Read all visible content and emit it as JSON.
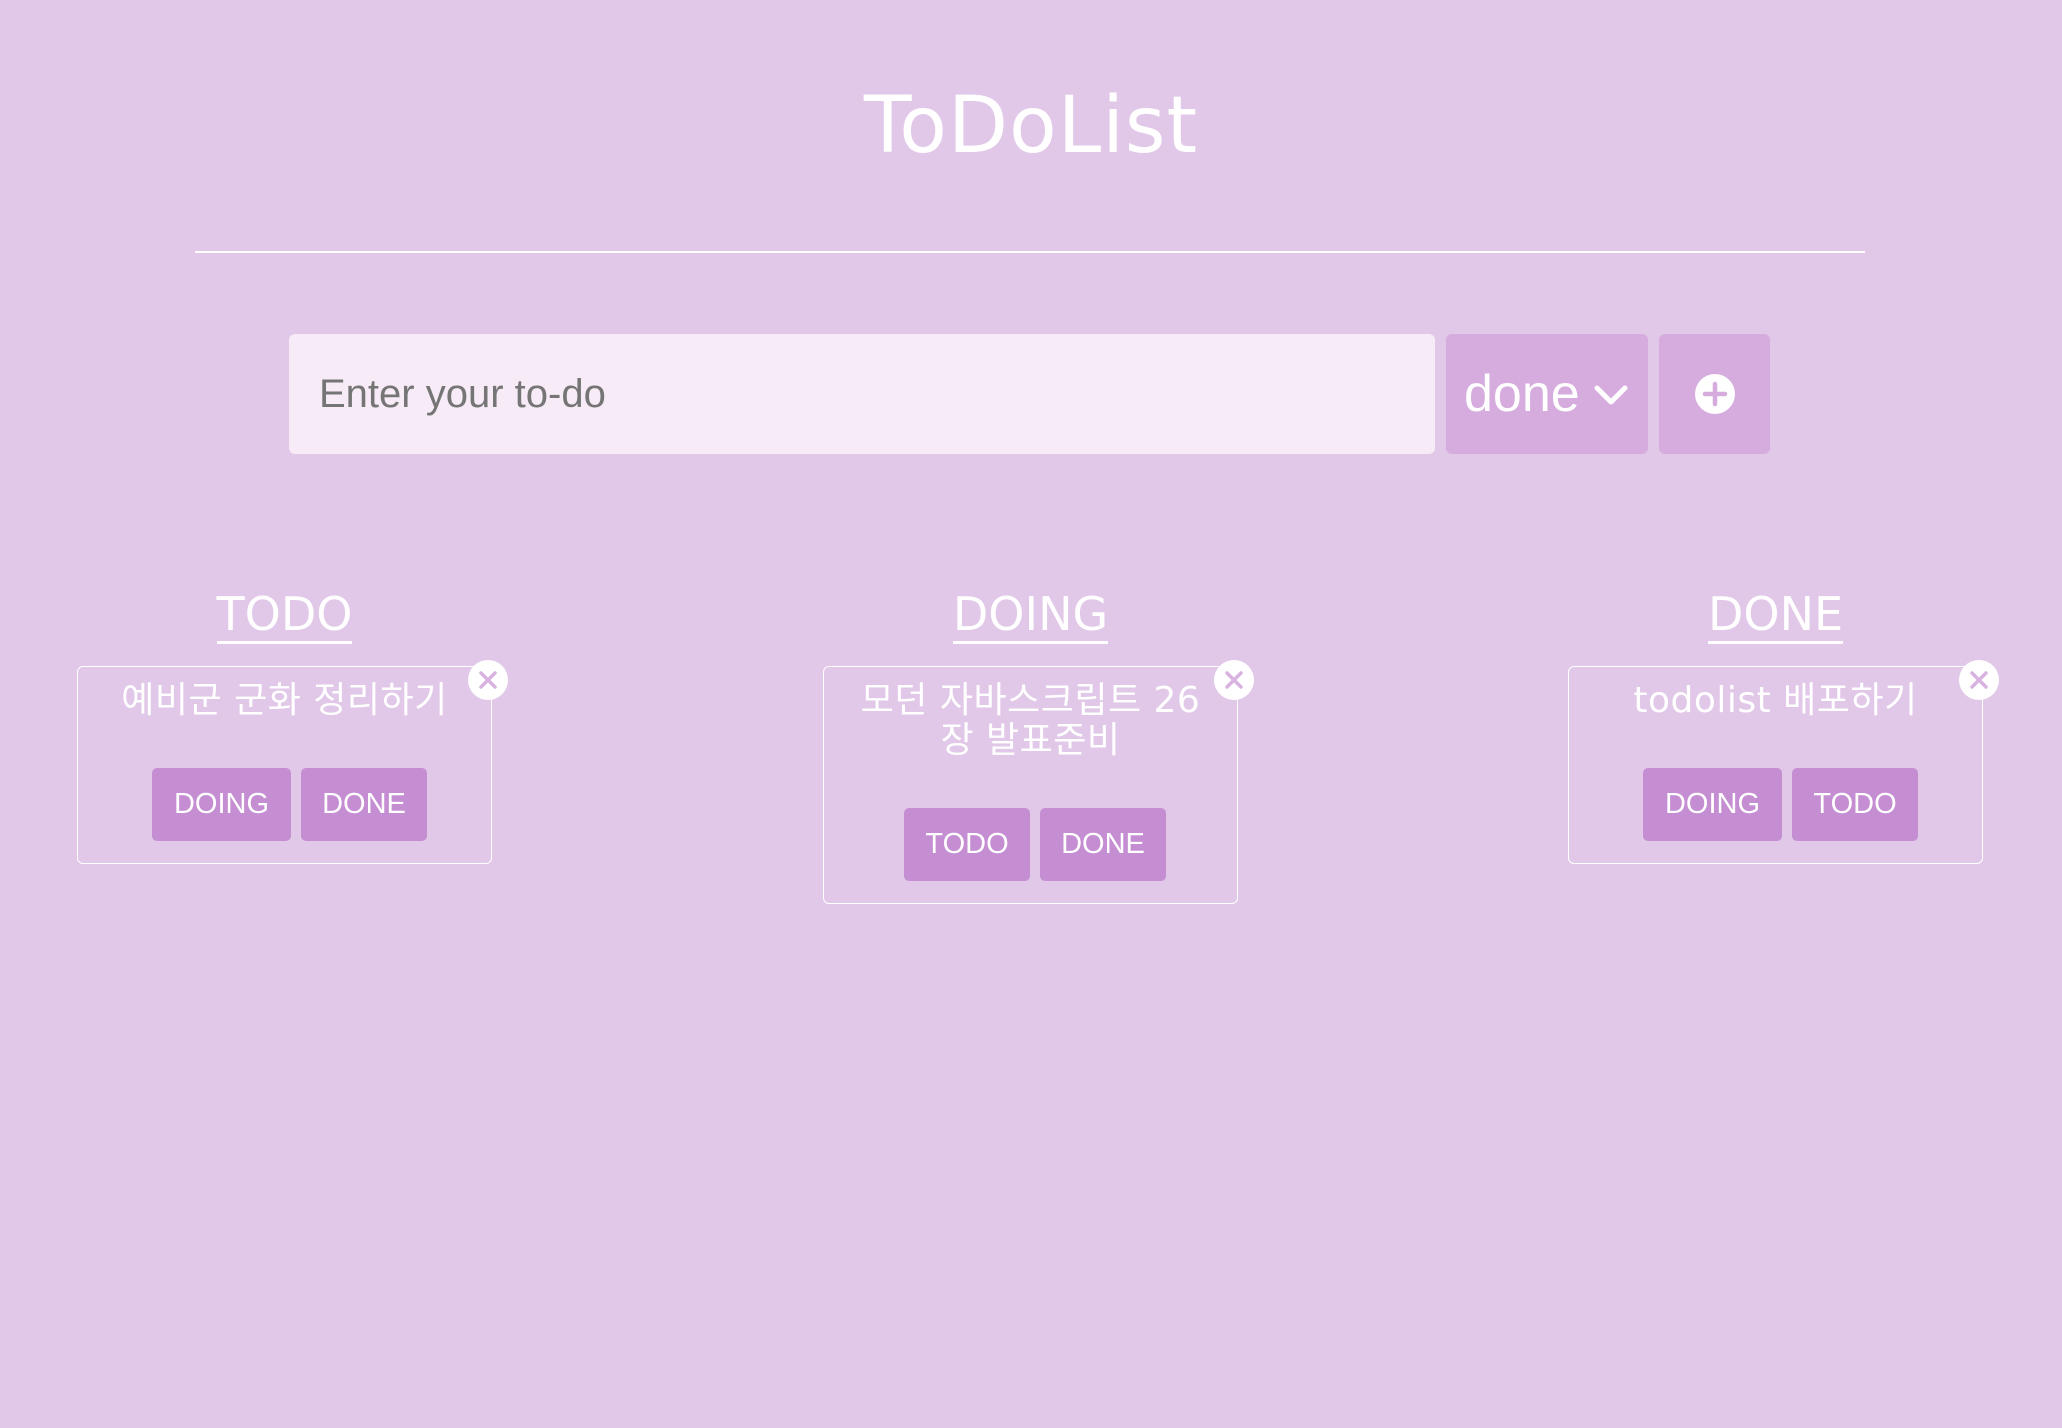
{
  "app": {
    "title": "ToDoList"
  },
  "input": {
    "placeholder": "Enter your to-do",
    "value": ""
  },
  "status_select": {
    "selected": "done",
    "icon": "chevron-down-icon"
  },
  "add_button": {
    "icon": "plus-circle-icon"
  },
  "colors": {
    "background": "#e1c8e8",
    "input_background": "#f7ebf7",
    "select_background": "#d5acdd",
    "button_background": "#c68ed2",
    "text": "#ffffff"
  },
  "columns": [
    {
      "heading": "TODO",
      "cards": [
        {
          "text": "예비군 군화 정리하기",
          "buttons": [
            "DOING",
            "DONE"
          ]
        }
      ]
    },
    {
      "heading": "DOING",
      "cards": [
        {
          "text_line1": "모던 자바스크립트 26",
          "text_line2": "장 발표준비",
          "buttons": [
            "TODO",
            "DONE"
          ]
        }
      ]
    },
    {
      "heading": "DONE",
      "cards": [
        {
          "text": "todolist 배포하기",
          "buttons": [
            "DOING",
            "TODO"
          ]
        }
      ]
    }
  ]
}
